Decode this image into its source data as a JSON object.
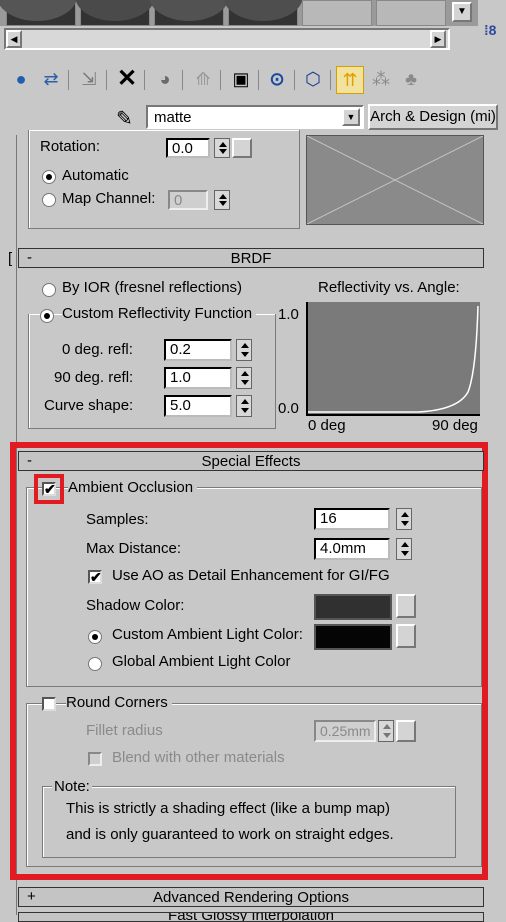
{
  "material": {
    "name": "matte",
    "type_button": "Arch & Design (mi)"
  },
  "coords": {
    "rotation_label": "Rotation:",
    "rotation_value": "0.0",
    "automatic_label": "Automatic",
    "map_channel_label": "Map Channel:",
    "map_channel_value": "0"
  },
  "brdf": {
    "sign": "-",
    "title": "BRDF",
    "by_ior_label": "By IOR (fresnel reflections)",
    "custom_label": "Custom Reflectivity Function",
    "deg0_label": "0 deg. refl:",
    "deg0_value": "0.2",
    "deg90_label": "90 deg. refl:",
    "deg90_value": "1.0",
    "curve_label": "Curve shape:",
    "curve_value": "5.0",
    "graph_title": "Reflectivity vs. Angle:",
    "y_max": "1.0",
    "y_min": "0.0",
    "x_min": "0 deg",
    "x_max": "90 deg"
  },
  "special_effects": {
    "sign": "-",
    "title": "Special Effects",
    "ao_label": "Ambient Occlusion",
    "ao_checked": "✔",
    "samples_label": "Samples:",
    "samples_value": "16",
    "max_distance_label": "Max Distance:",
    "max_distance_value": "4.0mm",
    "detail_checked": "✔",
    "detail_label": "Use AO as Detail Enhancement for GI/FG",
    "shadow_color_label": "Shadow Color:",
    "custom_ambient_label": "Custom Ambient Light Color:",
    "global_ambient_label": "Global Ambient Light Color",
    "round_corners_label": "Round Corners",
    "fillet_radius_label": "Fillet radius",
    "fillet_radius_value": "0.25mm",
    "blend_label": "Blend with other materials",
    "note_label": "Note:",
    "note_line1": "This is strictly a shading effect (like a bump map)",
    "note_line2": "and is only guaranteed to work on straight edges."
  },
  "advanced": {
    "sign": "+",
    "title": "Advanced Rendering Options"
  },
  "next_rollout": {
    "title": "Fast Glossy Interpolation"
  },
  "colors": {
    "highlight": "#e01b22",
    "shadow_color": "#303030",
    "ambient_color": "#050505"
  }
}
